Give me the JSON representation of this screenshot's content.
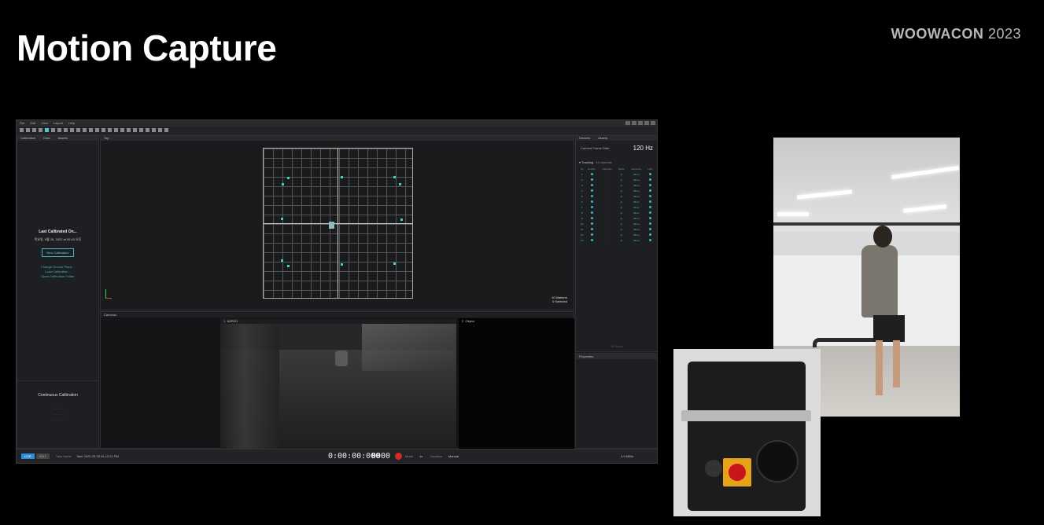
{
  "slide": {
    "title": "Motion Capture",
    "brand": "WOOWACON",
    "brand_year": "2023"
  },
  "app": {
    "menu": [
      "File",
      "Edit",
      "View",
      "Layout",
      "Help"
    ],
    "left_tabs": [
      "Calibration",
      "Data",
      "Assets"
    ],
    "viewport_label": "Top",
    "calibration": {
      "heading": "Last Calibrated On...",
      "date": "목요일, 9월 15, 2022 at 00:43 오후",
      "new_calibration": "New Calibration",
      "links": [
        "Change Ground Plane...",
        "Load Calibration...",
        "Open Calibration Folder"
      ],
      "continuous_title": "Continuous Calibration"
    },
    "viewport": {
      "markers": "10 Markers",
      "selected": "0 Selected"
    },
    "cameras": {
      "label": "Cameras",
      "cam1_num": "1",
      "cam1_type": "MJPEG",
      "cam2_num": "2",
      "cam2_type": "Object"
    },
    "devices": {
      "tabs": [
        "Devices",
        "Assets"
      ],
      "frame_rate_label": "Camera Frame Rate",
      "frame_rate": "120 Hz",
      "tracking_label": "Tracking",
      "tracking_count": "15 cameras",
      "columns": [
        "Nu",
        "Enable",
        "Methods",
        "Mode",
        "Exposure",
        "LED"
      ],
      "rows": [
        {
          "n": "1",
          "exp": "99 us"
        },
        {
          "n": "2",
          "exp": "99 us"
        },
        {
          "n": "3",
          "exp": "99 us"
        },
        {
          "n": "4",
          "exp": "99 us"
        },
        {
          "n": "5",
          "exp": "99 us"
        },
        {
          "n": "6",
          "exp": "99 us"
        },
        {
          "n": "7",
          "exp": "99 us"
        },
        {
          "n": "8",
          "exp": "99 us"
        },
        {
          "n": "9",
          "exp": "99 us"
        },
        {
          "n": "10",
          "exp": "99 us"
        },
        {
          "n": "11",
          "exp": "99 us"
        },
        {
          "n": "12",
          "exp": "99 us"
        },
        {
          "n": "13",
          "exp": "99 us"
        }
      ],
      "items": "50 Items"
    },
    "properties_label": "Properties",
    "status": {
      "live": "LIVE",
      "edit": "EDIT",
      "take_label": "Take Name",
      "take_name": "Take 2022-09-20 04.10.21 PM",
      "timecode": "0:00:00:000",
      "frame": "0000",
      "mode_label": "Mode",
      "speed": "1x",
      "duration_label": "Duration",
      "duration": "Manual",
      "data_rate": "4.9 MB/s"
    }
  }
}
